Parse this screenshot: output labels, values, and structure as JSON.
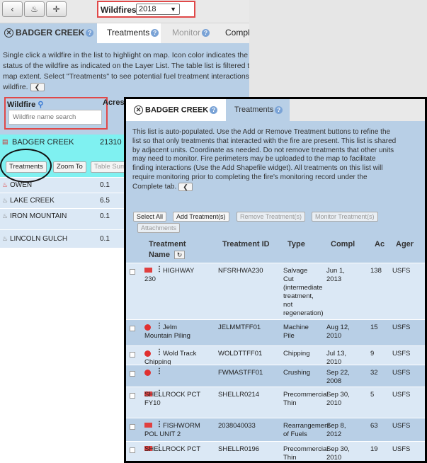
{
  "topbar": {
    "btn_back": "‹",
    "btn_fire": "♨",
    "btn_move": "✛",
    "wildfires_label": "Wildfires",
    "year": "2018"
  },
  "tabs": [
    {
      "label": "BADGER CREEK"
    },
    {
      "label": "Treatments"
    },
    {
      "label": "Monitor"
    },
    {
      "label": "Comple"
    }
  ],
  "instructions": [
    "Single click a wildfire in the list to highlight on map. Icon color indicates the",
    "status of the wildfire as indicated on the Layer List. The table list is filtered t",
    "map extent. Select \"Treatments\" to see potential fuel treatment interactions",
    "wildfire."
  ],
  "search": {
    "label": "Wildfire",
    "placeholder": "Wildfire name search",
    "acres_header": "Acres"
  },
  "wildfires": [
    {
      "name": "BADGER CREEK",
      "acres": "21310"
    },
    {
      "name": "OWEN",
      "acres": "0.1"
    },
    {
      "name": "LAKE CREEK",
      "acres": "6.5"
    },
    {
      "name": "IRON MOUNTAIN",
      "acres": "0.1"
    },
    {
      "name": "LINCOLN GULCH",
      "acres": "0.1"
    }
  ],
  "row_buttons": {
    "treatments": "Treatments",
    "zoom": "Zoom To",
    "summary": "Table Sum"
  },
  "dialog": {
    "tab_title": "BADGER CREEK",
    "tab_treatments": "Treatments",
    "intro": [
      "This list is auto-populated. Use the Add or Remove Treatment buttons to refine the",
      "list so that only treatments that interacted with the fire are present. This list is shared",
      "by adjacent units. Coordinate as needed. Do not remove treatments that other units",
      "may need to monitor. Fire perimeters may be uploaded to the map to facilitate",
      "finding interactions (Use the Add Shapefile widget). All treatments on this list will",
      "require monitoring prior to completing the fire's monitoring record under the",
      "Complete tab."
    ],
    "buttons": {
      "select_all": "Select All",
      "add": "Add Treatment(s)",
      "remove": "Remove Treatment(s)",
      "monitor": "Monitor Treatment(s)",
      "attachments": "Attachments"
    },
    "headers": {
      "name": "Treatment",
      "name2": "Name",
      "id": "Treatment ID",
      "type": "Type",
      "compl": "Compl",
      "acres": "Ac",
      "agency": "Ager"
    },
    "rows": [
      {
        "name": [
          "HIGHWAY",
          "230"
        ],
        "id": "NFSRHWA230",
        "type": [
          "Salvage",
          "Cut",
          "(intermediate",
          "treatment,",
          "not",
          "regeneration)"
        ],
        "date": [
          "Jun 1,",
          "2013"
        ],
        "acres": "138",
        "agency": "USFS",
        "marker": "flag"
      },
      {
        "name": [
          "Jelm",
          "Mountain Piling"
        ],
        "id": "JELMMTFF01",
        "type": [
          "Machine",
          "Pile"
        ],
        "date": [
          "Aug 12,",
          "2010"
        ],
        "acres": "15",
        "agency": "USFS",
        "marker": "dot"
      },
      {
        "name": [
          "Wold Track",
          "Chipping"
        ],
        "id": "WOLDTTFF01",
        "type": [
          "Chipping"
        ],
        "date": [
          "Jul 13,",
          "2010"
        ],
        "acres": "9",
        "agency": "USFS",
        "marker": "dot"
      },
      {
        "name": [
          ""
        ],
        "id": "FWMASTFF01",
        "type": [
          "Crushing"
        ],
        "date": [
          "Sep 22,",
          "2008"
        ],
        "acres": "32",
        "agency": "USFS",
        "marker": "dot"
      },
      {
        "name": [
          "",
          "SHELLROCK PCT",
          "FY10"
        ],
        "id": "SHELLR0214",
        "type": [
          "Precommercial",
          "Thin"
        ],
        "date": [
          "Sep 30,",
          "2010"
        ],
        "acres": "5",
        "agency": "USFS",
        "marker": "flag"
      },
      {
        "name": [
          "FISHWORM",
          "POL UNIT 2"
        ],
        "id": "2038040033",
        "type": [
          "Rearrangement",
          "of Fuels"
        ],
        "date": [
          "Sep 8,",
          "2012"
        ],
        "acres": "63",
        "agency": "USFS",
        "marker": "flag"
      },
      {
        "name": [
          "",
          "SHELLROCK PCT"
        ],
        "id": "SHELLR0196",
        "type": [
          "Precommercial",
          "Thin"
        ],
        "date": [
          "Sep 30,",
          "2010"
        ],
        "acres": "19",
        "agency": "USFS",
        "marker": "flag"
      }
    ]
  }
}
